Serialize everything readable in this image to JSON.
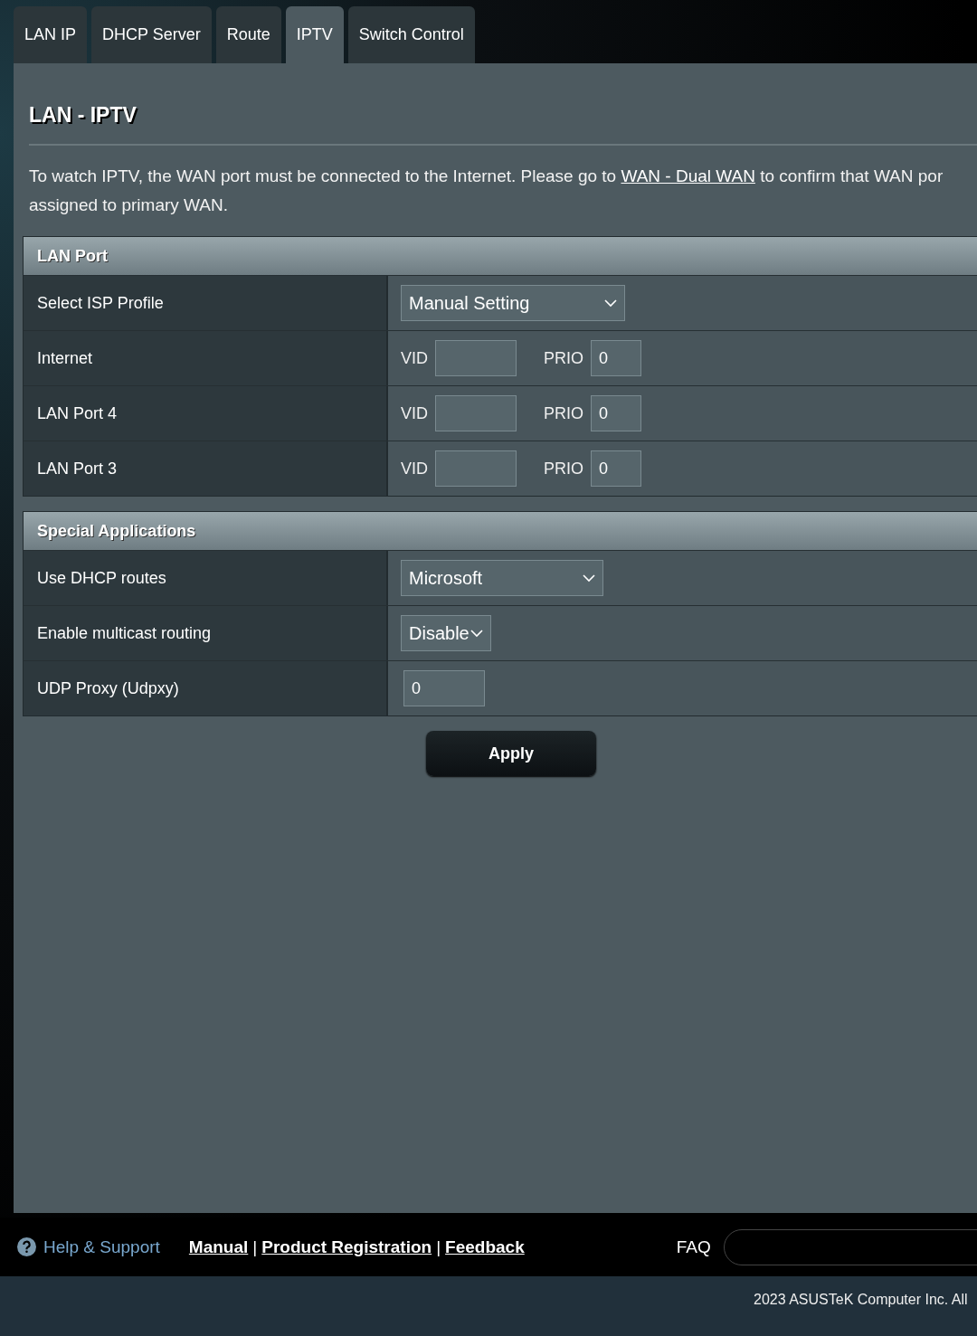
{
  "tabs": [
    {
      "label": "LAN IP",
      "selected": false
    },
    {
      "label": "DHCP Server",
      "selected": false
    },
    {
      "label": "Route",
      "selected": false
    },
    {
      "label": "IPTV",
      "selected": true
    },
    {
      "label": "Switch Control",
      "selected": false
    }
  ],
  "page_title": "LAN - IPTV",
  "notice": {
    "before": "To watch IPTV, the WAN port must be connected to the Internet. Please go to ",
    "link": "WAN - Dual WAN",
    "after": " to confirm that WAN por",
    "line2": "assigned to primary WAN."
  },
  "sections": [
    {
      "title": "LAN Port",
      "rows": [
        {
          "kind": "select",
          "label": "Select ISP Profile",
          "value": "Manual Setting"
        },
        {
          "kind": "vid_prio",
          "label": "Internet",
          "vid_label": "VID",
          "vid": "",
          "prio_label": "PRIO",
          "prio": "0"
        },
        {
          "kind": "vid_prio",
          "label": "LAN Port 4",
          "vid_label": "VID",
          "vid": "",
          "prio_label": "PRIO",
          "prio": "0"
        },
        {
          "kind": "vid_prio",
          "label": "LAN Port 3",
          "vid_label": "VID",
          "vid": "",
          "prio_label": "PRIO",
          "prio": "0"
        }
      ]
    },
    {
      "title": "Special Applications",
      "rows": [
        {
          "kind": "select",
          "label": "Use DHCP routes",
          "value": "Microsoft"
        },
        {
          "kind": "select",
          "label": "Enable multicast routing",
          "value": "Disable"
        },
        {
          "kind": "input",
          "label": "UDP Proxy (Udpxy)",
          "value": "0"
        }
      ]
    }
  ],
  "apply_button": "Apply",
  "footer": {
    "help": "Help & Support",
    "links": [
      "Manual",
      "Product Registration",
      "Feedback"
    ],
    "separator": "|",
    "faq": "FAQ",
    "copyright": "2023 ASUSTeK Computer Inc. All"
  }
}
